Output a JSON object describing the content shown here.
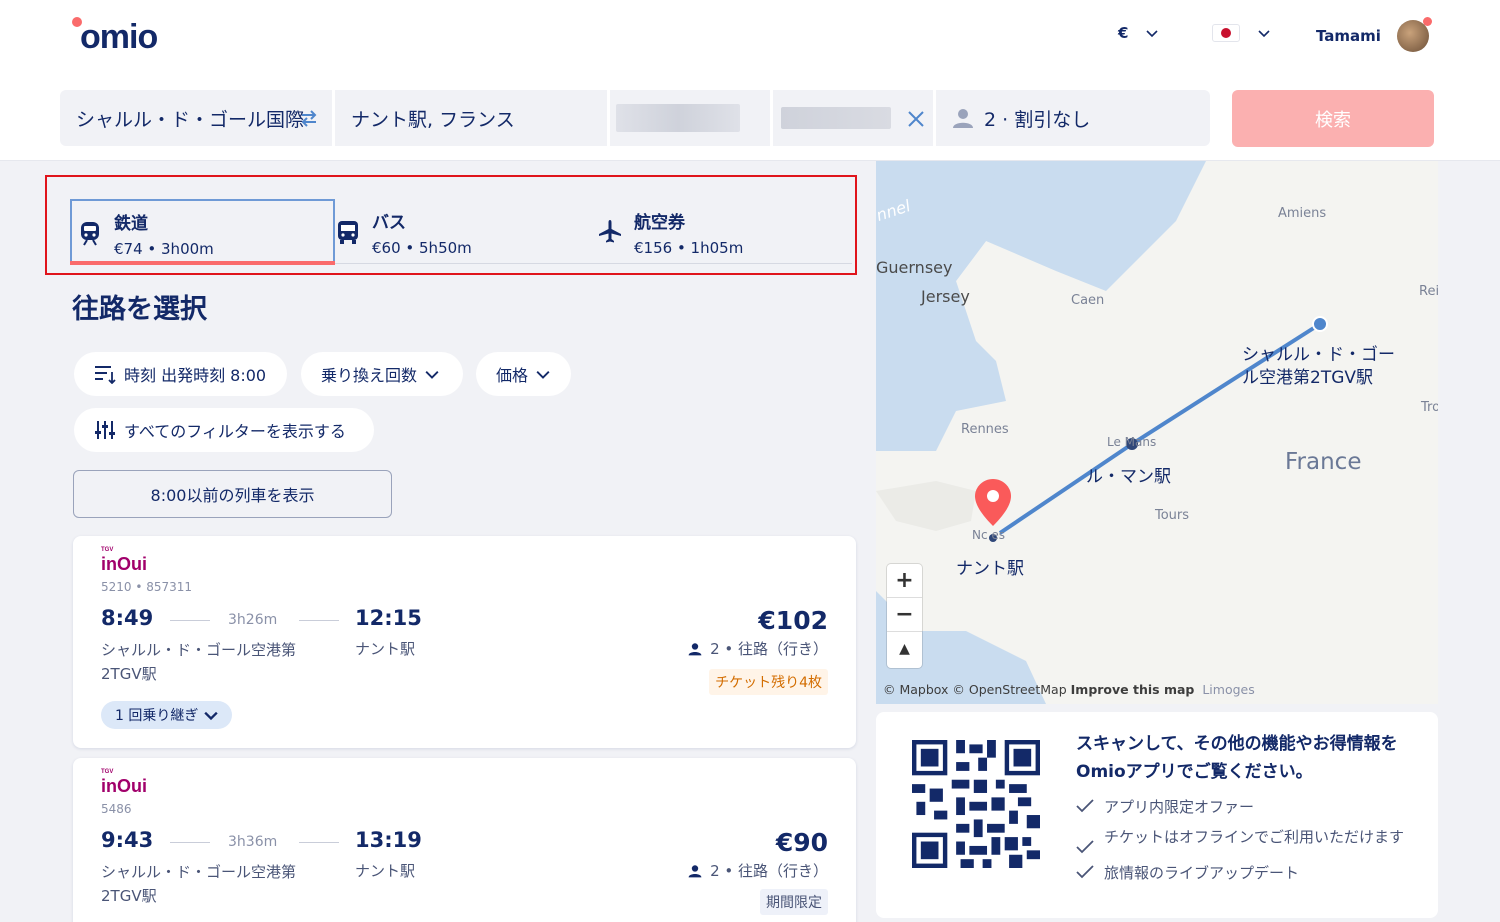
{
  "header": {
    "logo": "omio",
    "currency": "€",
    "user_name": "Tamami"
  },
  "search": {
    "from": "シャルル・ド・ゴール国際",
    "to": "ナント駅, フランス",
    "passengers": "2 · 割引なし",
    "search_button": "検索"
  },
  "modes": [
    {
      "label": "鉄道",
      "summary": "€74 • 3h00m",
      "icon": "train-icon"
    },
    {
      "label": "バス",
      "summary": "€60 • 5h50m",
      "icon": "bus-icon"
    },
    {
      "label": "航空券",
      "summary": "€156 • 1h05m",
      "icon": "plane-icon"
    }
  ],
  "page_title": "往路を選択",
  "filters": {
    "time": "時刻 出発時刻 8:00",
    "transfers": "乗り換え回数",
    "price": "価格",
    "all_filters": "すべてのフィルターを表示する",
    "earlier_trains": "8:00以前の列車を表示"
  },
  "results": [
    {
      "brand": "inOui",
      "brand_prefix": "TGV",
      "train_numbers": "5210 • 857311",
      "departure": "8:49",
      "duration": "3h26m",
      "arrival": "12:15",
      "from_station": "シャルル・ド・ゴール空港第2TGV駅",
      "to_station": "ナント駅",
      "price": "€102",
      "passengers": "2 • 往路（行き）",
      "badge": "チケット残り4枚",
      "transfers": "1 回乗り継ぎ"
    },
    {
      "brand": "inOui",
      "brand_prefix": "TGV",
      "train_numbers": "5486",
      "departure": "9:43",
      "duration": "3h36m",
      "arrival": "13:19",
      "from_station": "シャルル・ド・ゴール空港第2TGV駅",
      "to_station": "ナント駅",
      "price": "€90",
      "passengers": "2 • 往路（行き）",
      "badge": "期間限定"
    }
  ],
  "map": {
    "places": {
      "channel": "nnel",
      "guernsey": "Guernsey",
      "jersey": "Jersey",
      "caen": "Caen",
      "amiens": "Amiens",
      "reims": "Rei",
      "troyes": "Tro",
      "rennes": "Rennes",
      "le_mans": "Le Mans",
      "tours": "Tours",
      "nantes": "Nc es",
      "country": "France",
      "limoges": "Limoges"
    },
    "stations": {
      "origin": "シャルル・ド・ゴール空港第2TGV駅",
      "via": "ル・マン駅",
      "destination": "ナント駅"
    },
    "zoom_in": "+",
    "zoom_out": "−",
    "compass": "▲",
    "attribution": "© Mapbox © OpenStreetMap",
    "improve": "Improve this map"
  },
  "app_promo": {
    "title": "スキャンして、その他の機能やお得情報をOmioアプリでご覧ください。",
    "features": [
      "アプリ内限定オファー",
      "チケットはオフラインでご利用いただけます",
      "旅情報のライブアップデート"
    ]
  },
  "colors": {
    "brand_navy": "#132968",
    "accent_coral": "#fa6b6b",
    "search_button": "#fbb0b0",
    "highlight_border": "#e0141c",
    "route_line": "#4f86cc"
  }
}
